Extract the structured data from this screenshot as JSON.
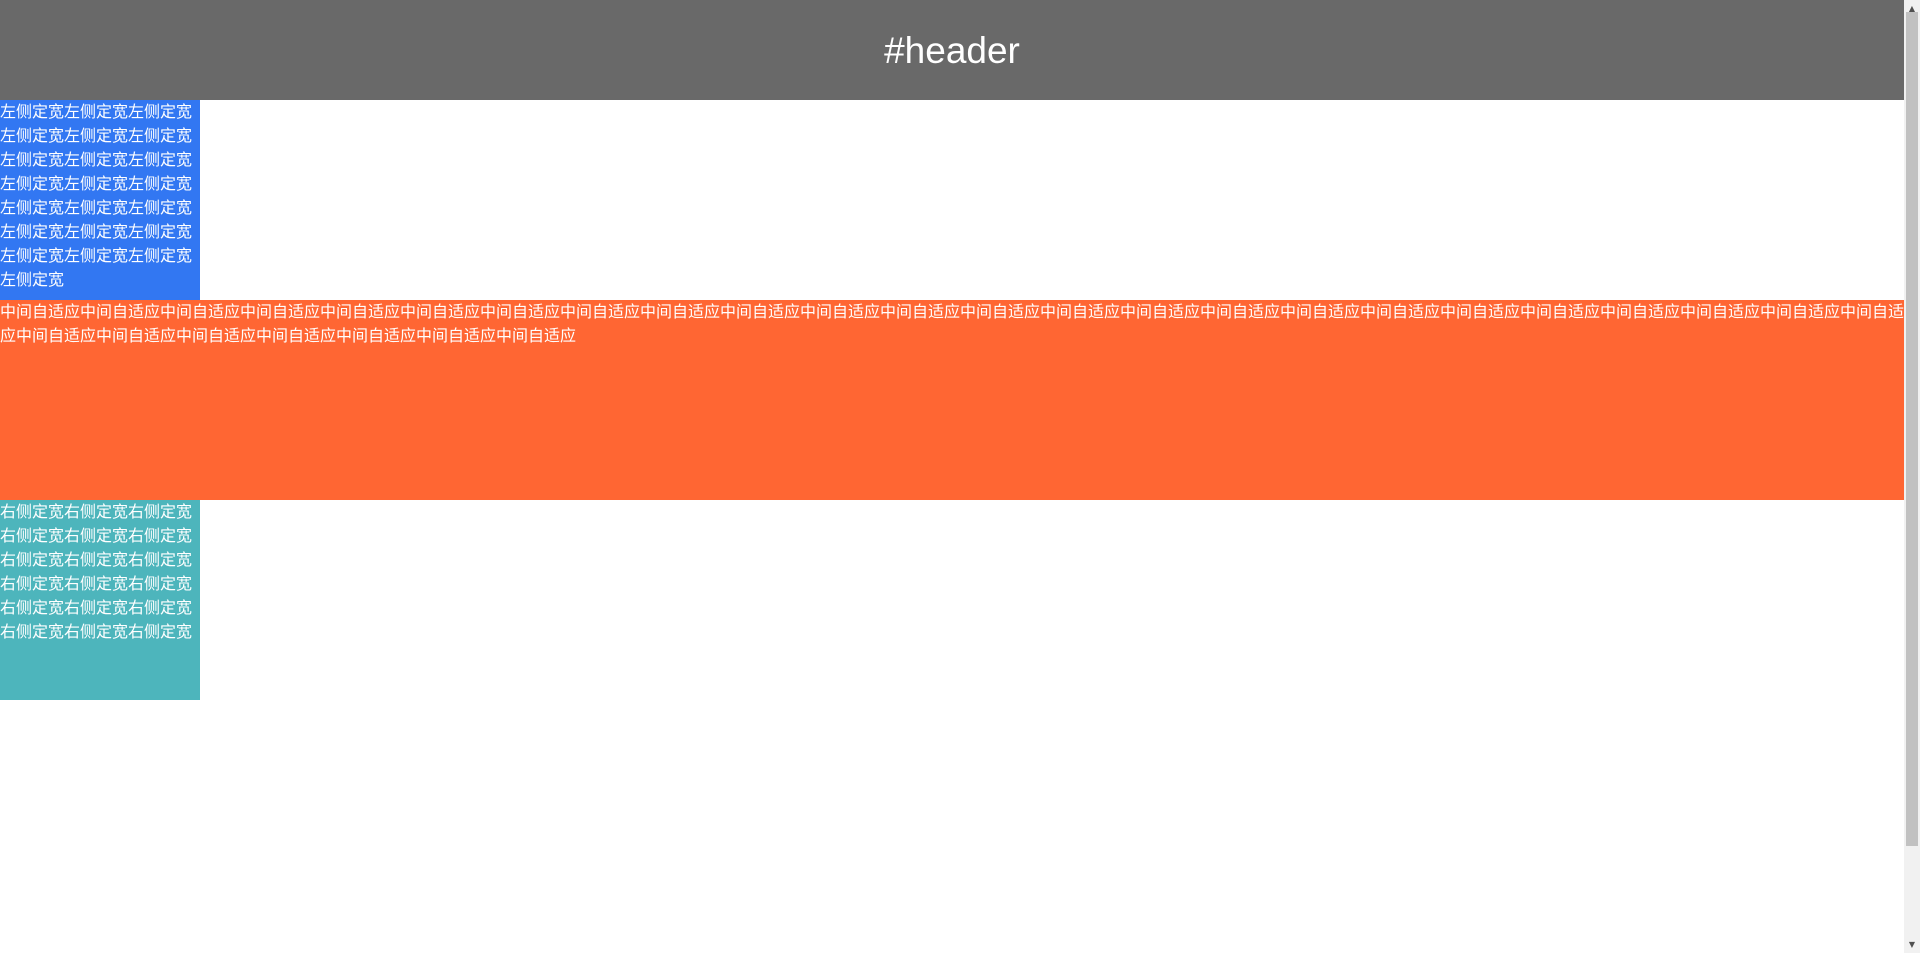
{
  "header": {
    "title": "#header",
    "background": "#696969"
  },
  "left": {
    "text": "左侧定宽左侧定宽左侧定宽左侧定宽左侧定宽左侧定宽左侧定宽左侧定宽左侧定宽左侧定宽左侧定宽左侧定宽左侧定宽左侧定宽左侧定宽左侧定宽左侧定宽左侧定宽左侧定宽左侧定宽左侧定宽左侧定宽",
    "background": "#3277f2"
  },
  "middle": {
    "text": "中间自适应中间自适应中间自适应中间自适应中间自适应中间自适应中间自适应中间自适应中间自适应中间自适应中间自适应中间自适应中间自适应中间自适应中间自适应中间自适应中间自适应中间自适应中间自适应中间自适应中间自适应中间自适应中间自适应中间自适应中间自适应中间自适应中间自适应中间自适应中间自适应中间自适应中间自适应",
    "background": "#ff6633"
  },
  "right": {
    "text": "右侧定宽右侧定宽右侧定宽右侧定宽右侧定宽右侧定宽右侧定宽右侧定宽右侧定宽右侧定宽右侧定宽右侧定宽右侧定宽右侧定宽右侧定宽右侧定宽右侧定宽右侧定宽",
    "background": "#4db5bc"
  },
  "scrollbar": {
    "up_arrow": "▲",
    "down_arrow": "▼"
  }
}
